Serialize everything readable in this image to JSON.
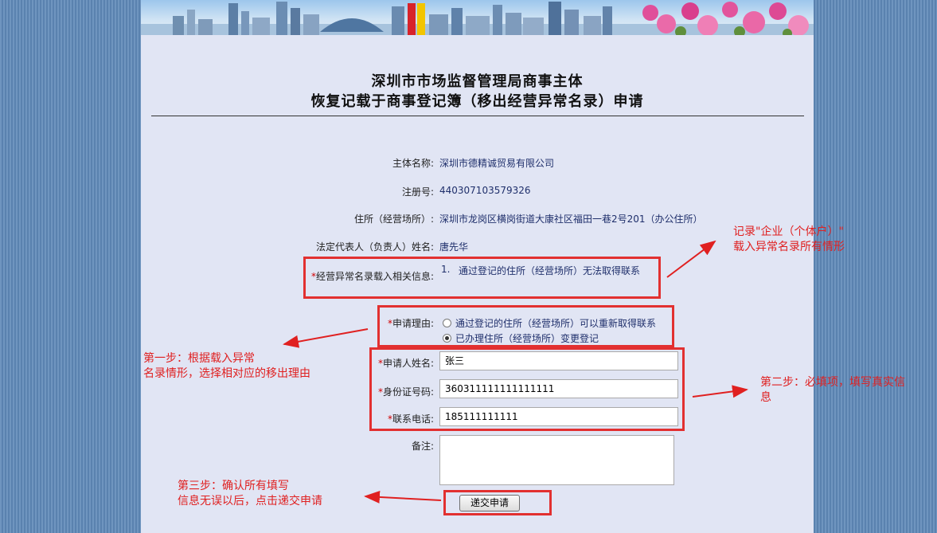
{
  "titles": {
    "line1": "深圳市市场监督管理局商事主体",
    "line2": "恢复记载于商事登记簿（移出经营异常名录）申请"
  },
  "info": {
    "entity_label": "主体名称:",
    "entity_value": "深圳市德精诚贸易有限公司",
    "reg_label": "注册号:",
    "reg_value": "440307103579326",
    "address_label": "住所（经营场所）:",
    "address_value": "深圳市龙岗区横岗街道大康社区福田一巷2号201（办公住所）",
    "rep_label": "法定代表人（负责人）姓名:",
    "rep_value": "唐先华",
    "abnormal_label": "经营异常名录载入相关信息:",
    "abnormal_num": "1.",
    "abnormal_value": "通过登记的住所（经营场所）无法取得联系"
  },
  "form": {
    "required_mark": "*",
    "reason_label": "申请理由:",
    "reason_options": [
      {
        "label": "通过登记的住所（经营场所）可以重新取得联系",
        "checked": false
      },
      {
        "label": "已办理住所（经营场所）变更登记",
        "checked": true
      }
    ],
    "name_label": "申请人姓名:",
    "name_value": "张三",
    "id_label": "身份证号码:",
    "id_value": "360311111111111111",
    "phone_label": "联系电话:",
    "phone_value": "185111111111",
    "remark_label": "备注:",
    "submit_label": "递交申请"
  },
  "annotations": {
    "record_note_1": "记录\"企业（个体户）\"",
    "record_note_2": "载入异常名录所有情形",
    "step1_line1": "第一步：根据载入异常",
    "step1_line2": "名录情形，选择相对应的移出理由",
    "step2_line1": "第二步：必填项，填写真实信",
    "step2_line2": "息",
    "step3_line1": "第三步：确认所有填写",
    "step3_line2": "信息无误以后，点击递交申请"
  },
  "colors": {
    "annotation_red": "#e02020",
    "page_bg": "#e1e5f4",
    "outer_bg": "#5f89b8",
    "value_text": "#1f2f6b"
  }
}
